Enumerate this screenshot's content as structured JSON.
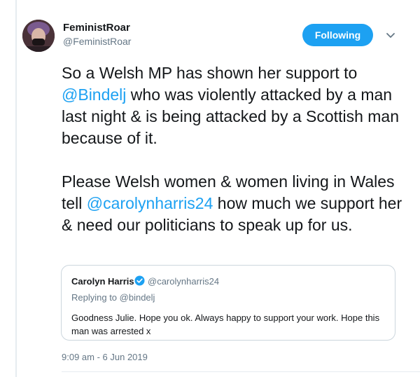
{
  "author": {
    "display_name": "FeministRoar",
    "handle": "@FeministRoar"
  },
  "follow_button": {
    "label": "Following"
  },
  "tweet": {
    "para1_part1": "So a Welsh MP has shown her support to ",
    "mention1": "@Bindelj",
    "para1_part2": " who was violently attacked by a man last night & is being attacked by a Scottish man because of it.",
    "para2_part1": "Please Welsh women & women living in Wales tell ",
    "mention2": "@carolynharris24",
    "para2_part2": " how much we support her & need our politicians to speak up for us."
  },
  "quoted_tweet": {
    "display_name": "Carolyn Harris",
    "handle": "@carolynharris24",
    "replying_to": "Replying to @bindelj",
    "text": "Goodness Julie. Hope you ok. Always happy to support your work. Hope this man was arrested x"
  },
  "timestamp": "9:09 am - 6 Jun 2019",
  "icons": {
    "verified": "verified-badge-icon",
    "caret": "chevron-down-icon"
  },
  "colors": {
    "accent": "#1da1f2",
    "secondary_text": "#657786",
    "border": "#ccd6dd"
  }
}
